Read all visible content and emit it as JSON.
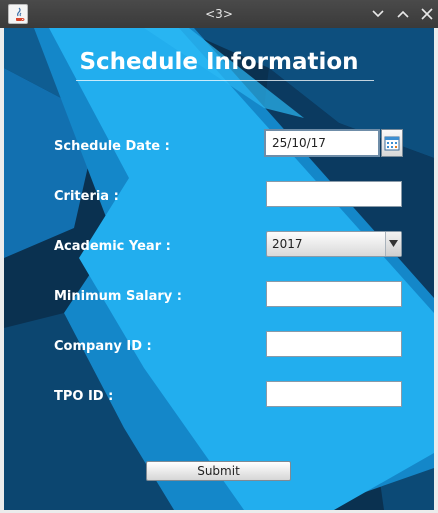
{
  "window": {
    "title": "<3>"
  },
  "form": {
    "heading": "Schedule Information",
    "schedule_date": {
      "label": "Schedule Date :",
      "value": "25/10/17"
    },
    "criteria": {
      "label": "Criteria :",
      "value": ""
    },
    "academic_year": {
      "label": "Academic Year :",
      "selected": "2017"
    },
    "minimum_salary": {
      "label": "Minimum Salary :",
      "value": ""
    },
    "company_id": {
      "label": "Company ID :",
      "value": ""
    },
    "tpo_id": {
      "label": "TPO ID :",
      "value": ""
    },
    "submit_label": "Submit"
  },
  "icons": {
    "app": "java-app-icon",
    "minimize": "chevron-down-icon",
    "maximize": "chevron-up-icon",
    "close": "close-icon",
    "calendar": "calendar-icon",
    "dropdown": "dropdown-arrow-icon"
  },
  "colors": {
    "background_dark": "#0a3150",
    "background_mid": "#1486c8",
    "background_light": "#24b0f0",
    "label_text": "#ffffff"
  }
}
